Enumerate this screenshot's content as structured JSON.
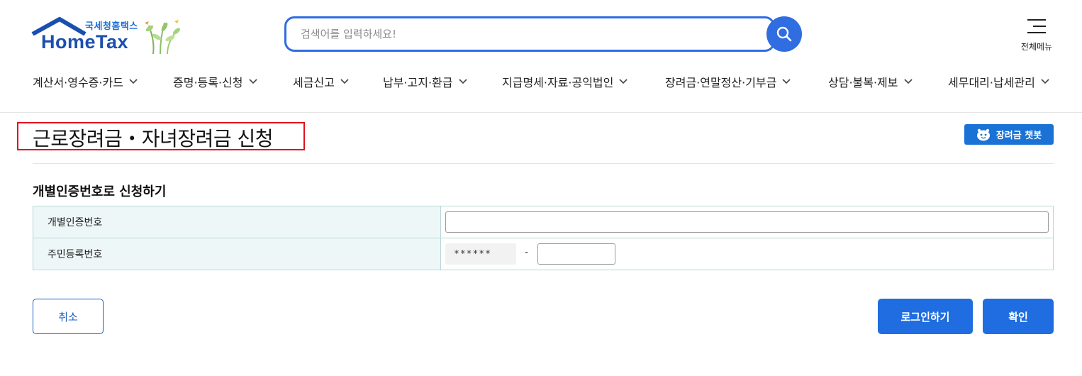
{
  "header": {
    "brand_sub": "국세청홈택스",
    "brand_main": "HomeTax",
    "search_placeholder": "검색어를 입력하세요!",
    "all_menu_label": "전체메뉴"
  },
  "nav": {
    "items": [
      {
        "label": "계산서·영수증·카드"
      },
      {
        "label": "증명·등록·신청"
      },
      {
        "label": "세금신고"
      },
      {
        "label": "납부·고지·환급"
      },
      {
        "label": "지급명세·자료·공익법인"
      },
      {
        "label": "장려금·연말정산·기부금"
      },
      {
        "label": "상담·불복·제보"
      },
      {
        "label": "세무대리·납세관리"
      }
    ]
  },
  "page": {
    "title": "근로장려금・자녀장려금 신청",
    "chatbot_label": "장려금 챗봇"
  },
  "section": {
    "title": "개별인증번호로 신청하기",
    "rows": [
      {
        "label": "개별인증번호"
      },
      {
        "label": "주민등록번호"
      }
    ],
    "rrn_front_masked": "******",
    "rrn_dash": "-"
  },
  "buttons": {
    "cancel": "취소",
    "login": "로그인하기",
    "confirm": "확인"
  },
  "colors": {
    "primary": "#1f6de0",
    "highlight_border": "#e0141e",
    "table_label_bg": "#eef7f7"
  }
}
